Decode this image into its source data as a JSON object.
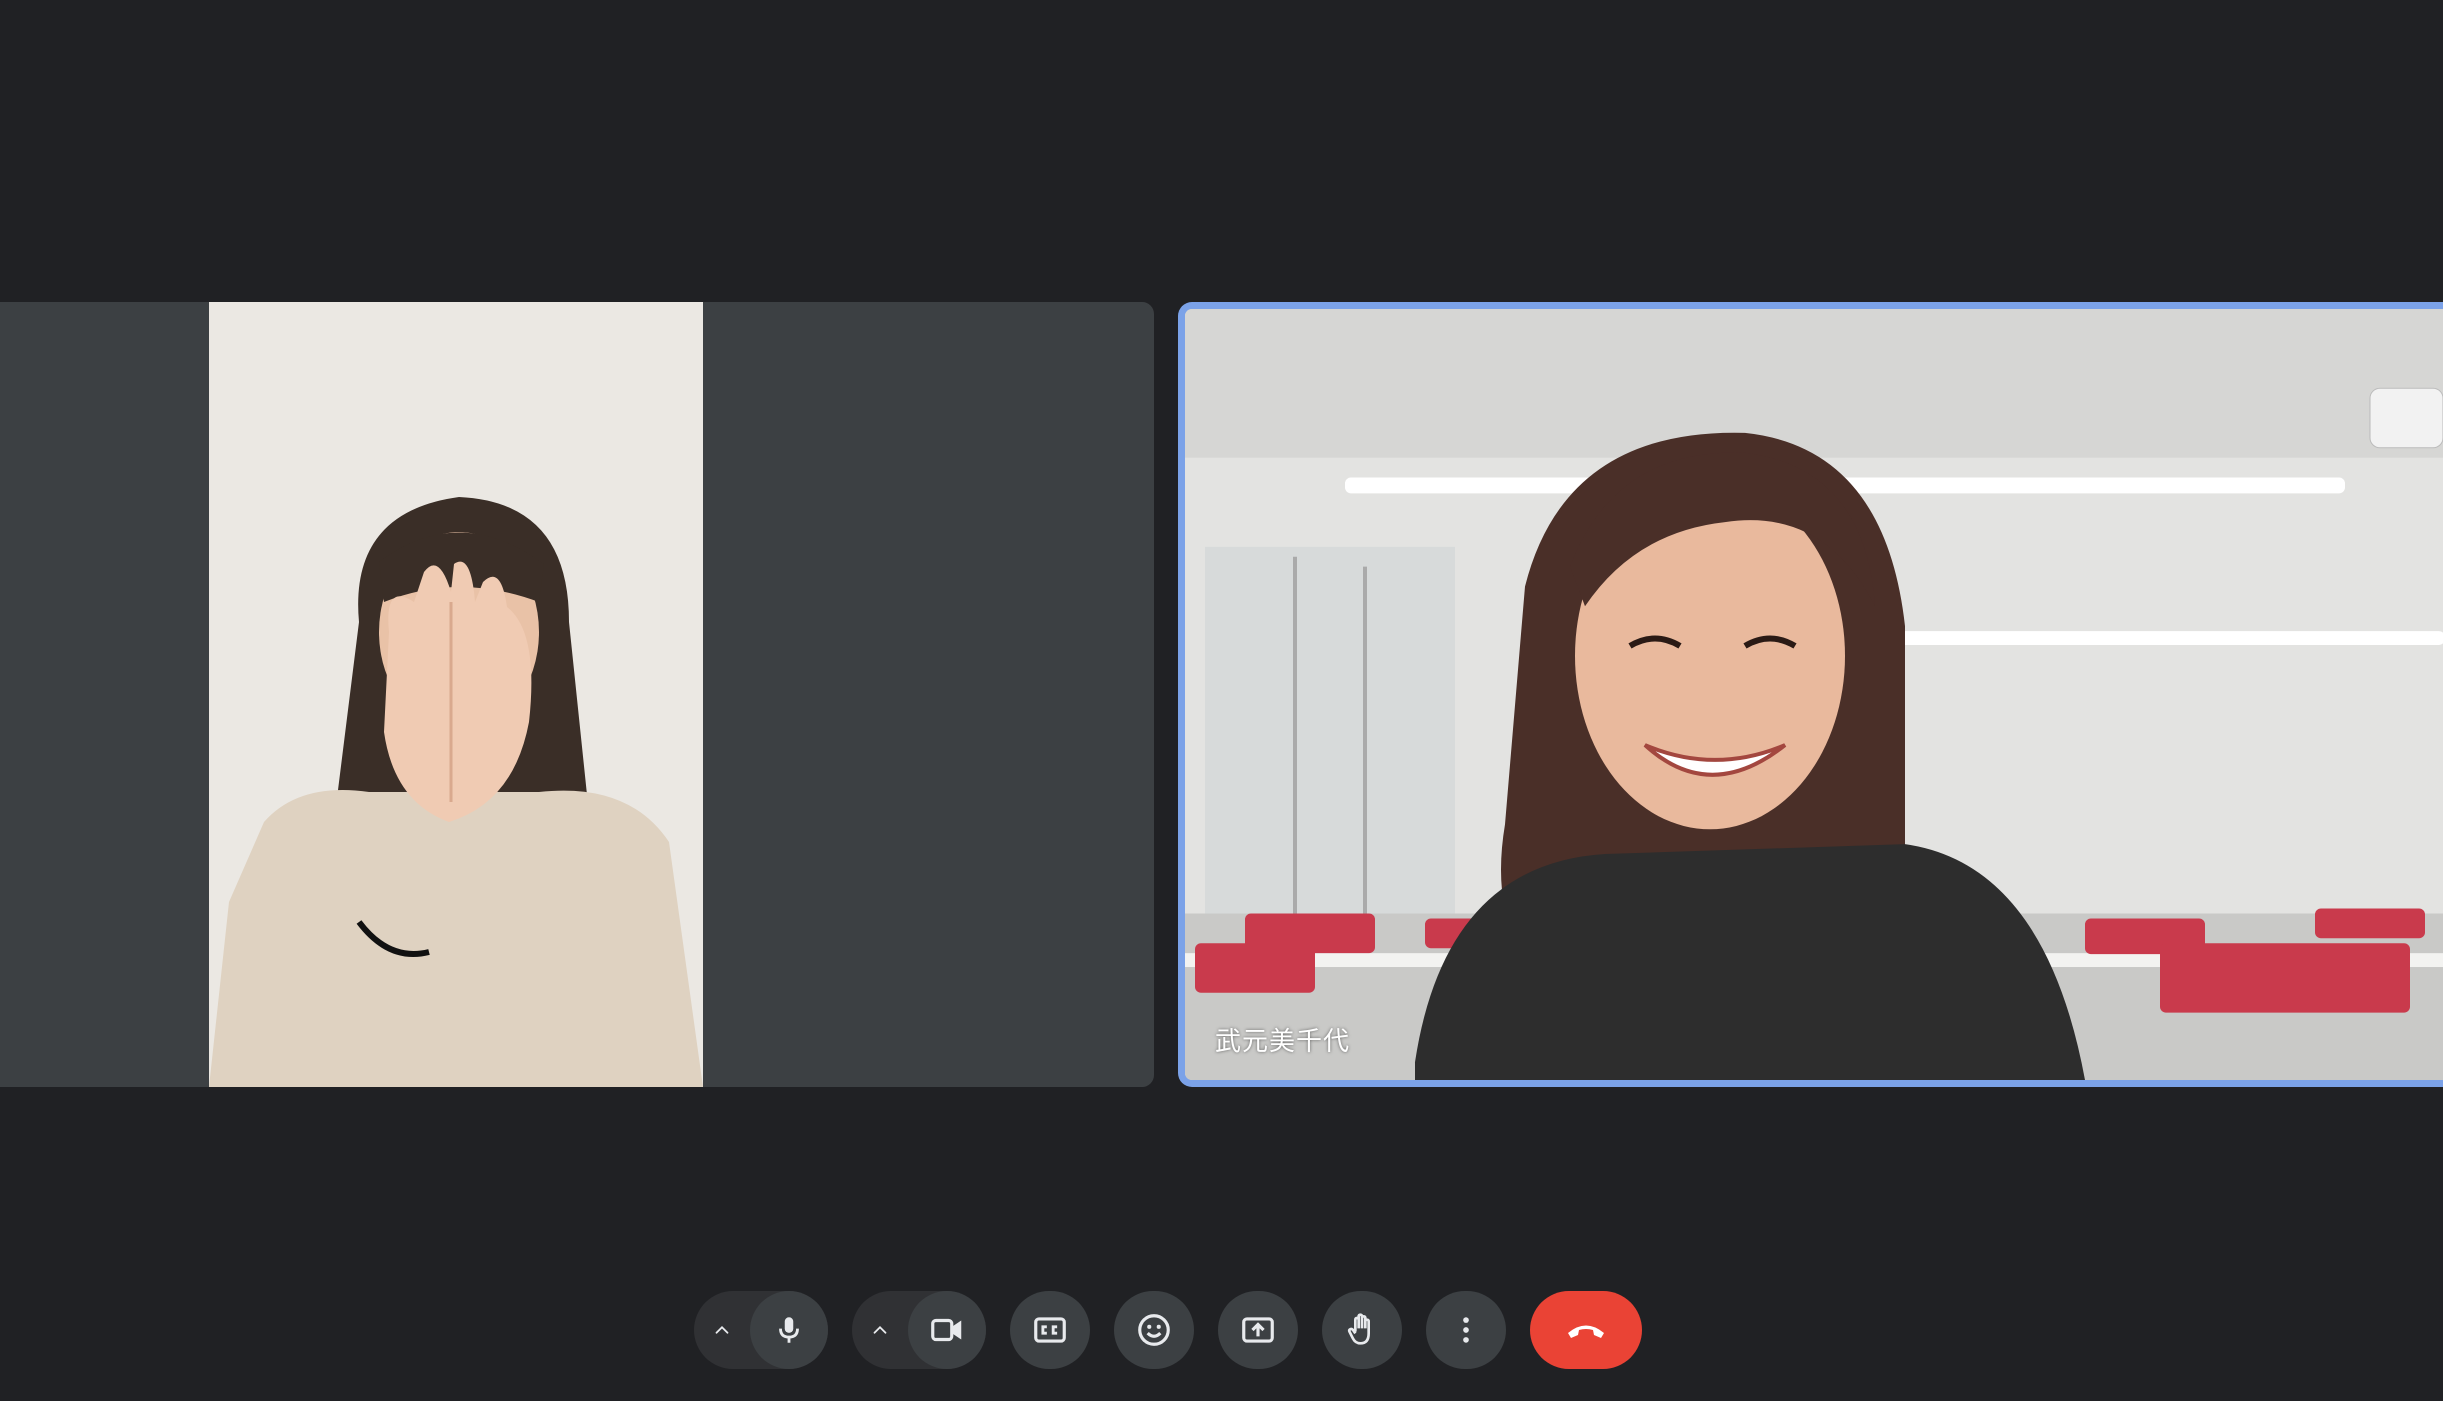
{
  "participants": [
    {
      "id": "left",
      "name": "",
      "active_speaker": false
    },
    {
      "id": "right",
      "name": "武元美千代",
      "active_speaker": true
    }
  ],
  "colors": {
    "background": "#202124",
    "tile": "#3c4043",
    "active_border": "#7ba2e8",
    "button": "#3c4043",
    "end_call": "#ea4335"
  },
  "controls": [
    {
      "name": "microphone",
      "icon": "mic-icon",
      "has_options": true
    },
    {
      "name": "camera",
      "icon": "videocam-icon",
      "has_options": true
    },
    {
      "name": "captions",
      "icon": "closed-caption-icon"
    },
    {
      "name": "reactions",
      "icon": "emoji-icon"
    },
    {
      "name": "present",
      "icon": "present-screen-icon"
    },
    {
      "name": "raise-hand",
      "icon": "hand-icon"
    },
    {
      "name": "more-options",
      "icon": "more-vert-icon"
    },
    {
      "name": "leave-call",
      "icon": "call-end-icon"
    }
  ]
}
